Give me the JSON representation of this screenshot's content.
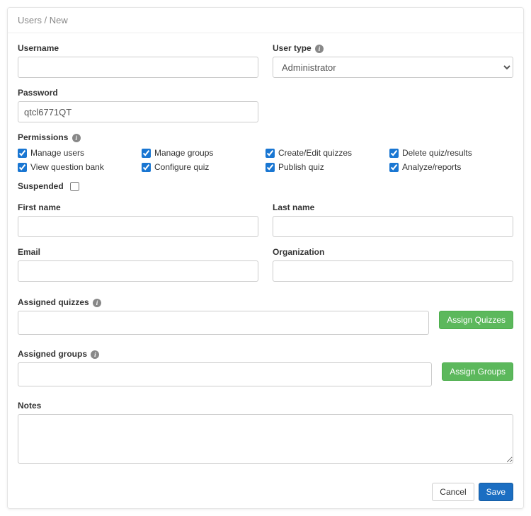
{
  "breadcrumb": "Users / New",
  "labels": {
    "username": "Username",
    "user_type": "User type",
    "password": "Password",
    "permissions": "Permissions",
    "suspended": "Suspended",
    "first_name": "First name",
    "last_name": "Last name",
    "email": "Email",
    "organization": "Organization",
    "assigned_quizzes": "Assigned quizzes",
    "assigned_groups": "Assigned groups",
    "notes": "Notes"
  },
  "values": {
    "username": "",
    "user_type": "Administrator",
    "password": "qtcl6771QT",
    "suspended": false,
    "first_name": "",
    "last_name": "",
    "email": "",
    "organization": "",
    "assigned_quizzes": "",
    "assigned_groups": "",
    "notes": ""
  },
  "permissions": [
    {
      "label": "Manage users",
      "checked": true
    },
    {
      "label": "Manage groups",
      "checked": true
    },
    {
      "label": "Create/Edit quizzes",
      "checked": true
    },
    {
      "label": "Delete quiz/results",
      "checked": true
    },
    {
      "label": "View question bank",
      "checked": true
    },
    {
      "label": "Configure quiz",
      "checked": true
    },
    {
      "label": "Publish quiz",
      "checked": true
    },
    {
      "label": "Analyze/reports",
      "checked": true
    }
  ],
  "buttons": {
    "assign_quizzes": "Assign Quizzes",
    "assign_groups": "Assign Groups",
    "cancel": "Cancel",
    "save": "Save"
  }
}
